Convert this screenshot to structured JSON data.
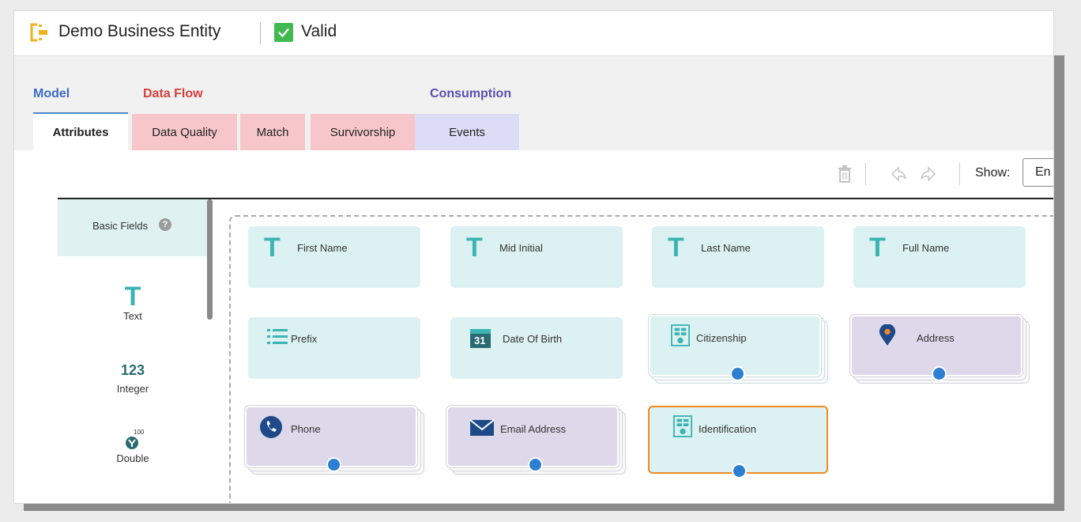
{
  "header": {
    "entity_name": "Demo Business Entity",
    "status_label": "Valid",
    "logo_icon": "business-entity-icon"
  },
  "tab_groups": {
    "model": "Model",
    "data_flow": "Data Flow",
    "consumption": "Consumption"
  },
  "tabs": {
    "attributes": "Attributes",
    "data_quality": "Data Quality",
    "match": "Match",
    "survivorship": "Survivorship",
    "events": "Events"
  },
  "toolbar": {
    "show_label": "Show:",
    "show_value": "En"
  },
  "palette": {
    "title": "Basic Fields",
    "help": "?",
    "items": [
      {
        "label": "Text",
        "glyph": "T"
      },
      {
        "label": "Integer",
        "glyph": "123"
      },
      {
        "label": "Double",
        "glyph": "100"
      }
    ]
  },
  "fields": [
    {
      "label": "First Name",
      "icon": "text-icon"
    },
    {
      "label": "Mid Initial",
      "icon": "text-icon"
    },
    {
      "label": "Last Name",
      "icon": "text-icon"
    },
    {
      "label": "Full Name",
      "icon": "text-icon"
    },
    {
      "label": "Prefix",
      "icon": "list-icon"
    },
    {
      "label": "Date Of Birth",
      "icon": "calendar-icon",
      "calendar_day": "31"
    },
    {
      "label": "Citizenship",
      "icon": "lookup-table-icon"
    },
    {
      "label": "Address",
      "icon": "location-pin-icon"
    },
    {
      "label": "Phone",
      "icon": "phone-icon"
    },
    {
      "label": "Email Address",
      "icon": "envelope-icon"
    },
    {
      "label": "Identification",
      "icon": "lookup-table-icon"
    }
  ],
  "colors": {
    "accent_blue": "#2d7fd3",
    "teal": "#3cb4b4",
    "selected_border": "#f08a24",
    "valid_green": "#3fb950"
  }
}
